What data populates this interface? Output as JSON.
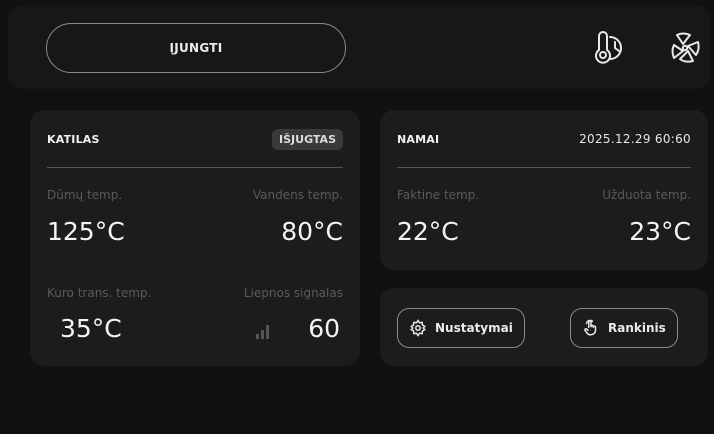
{
  "header": {
    "power_button": "ĮJUNGTI",
    "icons": [
      "thermometer-clock-icon",
      "fan-icon"
    ]
  },
  "boiler": {
    "title": "KATILAS",
    "status": "IŠJUGTAS",
    "flue_label": "Dūmų temp.",
    "flue_value": "125°C",
    "water_label": "Vandens temp.",
    "water_value": "80°C",
    "fuel_label": "Kuro trans. temp.",
    "fuel_value": "35°C",
    "flame_label": "Liepnos signalas",
    "flame_value": "60"
  },
  "home": {
    "title": "NAMAI",
    "datetime": "2025.12.29 60:60",
    "actual_label": "Faktine temp.",
    "actual_value": "22°C",
    "set_label": "Užduota temp.",
    "set_value": "23°C"
  },
  "actions": {
    "settings_label": "Nustatymai",
    "manual_label": "Rankinis"
  },
  "colors": {
    "background": "#111111",
    "card": "#1c1c1c",
    "muted_text": "#5a5a5a",
    "border": "#8a8a8a"
  }
}
